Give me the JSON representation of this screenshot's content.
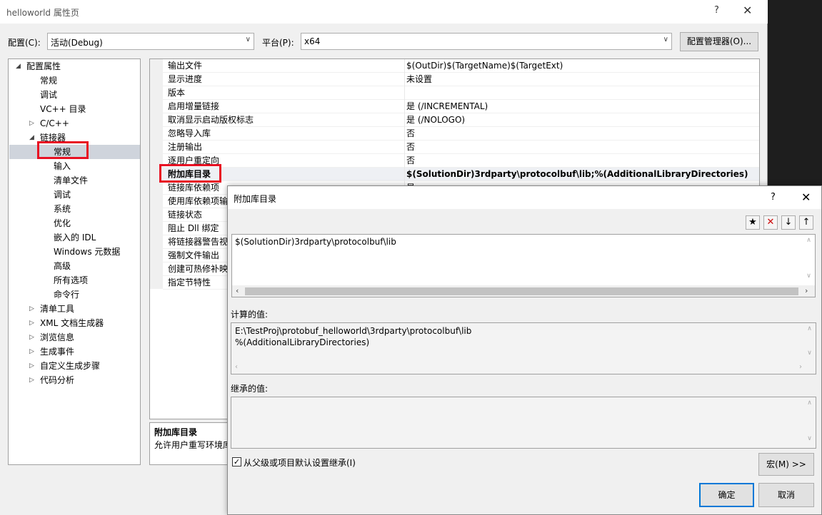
{
  "window": {
    "title": "helloworld 属性页",
    "help": "?",
    "close": "✕"
  },
  "toolbar": {
    "config_label": "配置(C):",
    "config_value": "活动(Debug)",
    "platform_label": "平台(P):",
    "platform_value": "x64",
    "config_manager": "配置管理器(O)..."
  },
  "tree": {
    "root": "配置属性",
    "items": [
      "常规",
      "调试",
      "VC++ 目录",
      "C/C++",
      "链接器"
    ],
    "linker_children": [
      "常规",
      "输入",
      "清单文件",
      "调试",
      "系统",
      "优化",
      "嵌入的 IDL",
      "Windows 元数据",
      "高级",
      "所有选项",
      "命令行"
    ],
    "bottom_items": [
      "清单工具",
      "XML 文档生成器",
      "浏览信息",
      "生成事件",
      "自定义生成步骤",
      "代码分析"
    ]
  },
  "grid": {
    "rows": [
      {
        "k": "输出文件",
        "v": "$(OutDir)$(TargetName)$(TargetExt)"
      },
      {
        "k": "显示进度",
        "v": "未设置"
      },
      {
        "k": "版本",
        "v": ""
      },
      {
        "k": "启用增量链接",
        "v": "是 (/INCREMENTAL)"
      },
      {
        "k": "取消显示启动版权标志",
        "v": "是 (/NOLOGO)"
      },
      {
        "k": "忽略导入库",
        "v": "否"
      },
      {
        "k": "注册输出",
        "v": "否"
      },
      {
        "k": "逐用户重定向",
        "v": "否"
      },
      {
        "k": "附加库目录",
        "v": "$(SolutionDir)3rdparty\\protocolbuf\\lib;%(AdditionalLibraryDirectories)"
      },
      {
        "k": "链接库依赖项",
        "v": "是"
      },
      {
        "k": "使用库依赖项输",
        "v": ""
      },
      {
        "k": "链接状态",
        "v": ""
      },
      {
        "k": "阻止 Dll 绑定",
        "v": ""
      },
      {
        "k": "将链接器警告视",
        "v": ""
      },
      {
        "k": "强制文件输出",
        "v": ""
      },
      {
        "k": "创建可热修补映",
        "v": ""
      },
      {
        "k": "指定节特性",
        "v": ""
      }
    ]
  },
  "description": {
    "title": "附加库目录",
    "text": "允许用户重写环境库"
  },
  "dialog": {
    "title": "附加库目录",
    "help": "?",
    "close": "✕",
    "entry": "$(SolutionDir)3rdparty\\protocolbuf\\lib",
    "computed_label": "计算的值:",
    "computed_lines": [
      "E:\\TestProj\\protobuf_helloworld\\3rdparty\\protocolbuf\\lib",
      "%(AdditionalLibraryDirectories)"
    ],
    "inherited_label": "继承的值:",
    "inherit_checkbox": "从父级或项目默认设置继承(I)",
    "inherit_checked": true,
    "macros_button": "宏(M) >>",
    "ok_button": "确定",
    "cancel_button": "取消"
  }
}
